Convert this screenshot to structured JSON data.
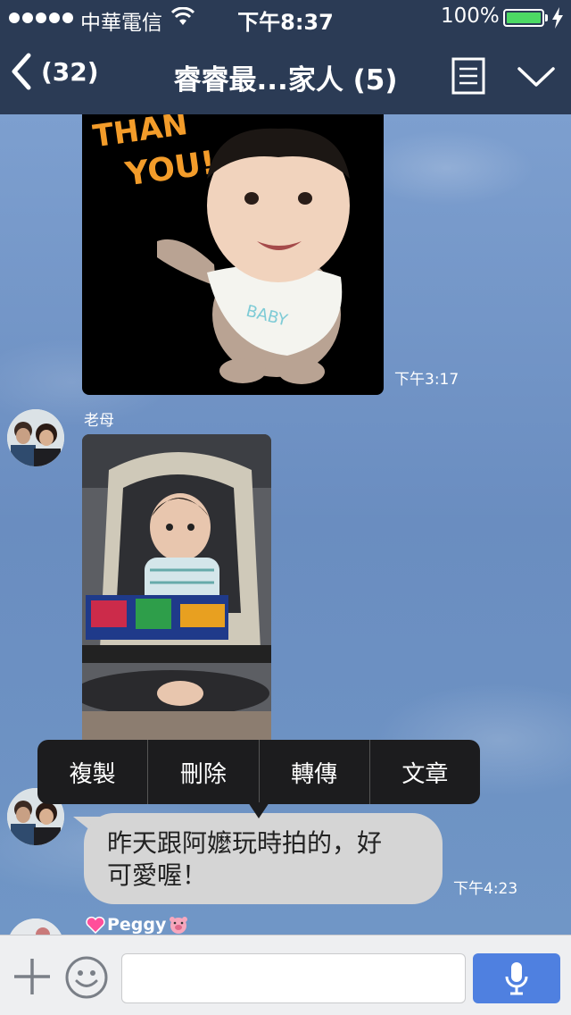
{
  "status_bar": {
    "carrier": "中華電信",
    "time": "下午8:37",
    "battery": "100%"
  },
  "nav": {
    "back_count": "(32)",
    "title": "睿睿最...家人 (5)"
  },
  "messages": [
    {
      "type": "sticker",
      "timestamp": "下午3:17"
    },
    {
      "type": "photo",
      "sender": "老母"
    },
    {
      "type": "text",
      "text_line1": "昨天跟阿嬤玩時拍的，好",
      "text_line2": "可愛喔！",
      "timestamp": "下午4:23"
    },
    {
      "type": "partial",
      "sender": "Peggy"
    }
  ],
  "sticker_text": {
    "line1": "THAN",
    "line2": "YOU!",
    "bib": "BABY"
  },
  "context_menu": [
    "複製",
    "刪除",
    "轉傳",
    "文章"
  ],
  "input": {
    "placeholder": ""
  },
  "colors": {
    "header": "#2b3b55",
    "mic_button": "#4f80e0",
    "battery": "#4cd964"
  }
}
